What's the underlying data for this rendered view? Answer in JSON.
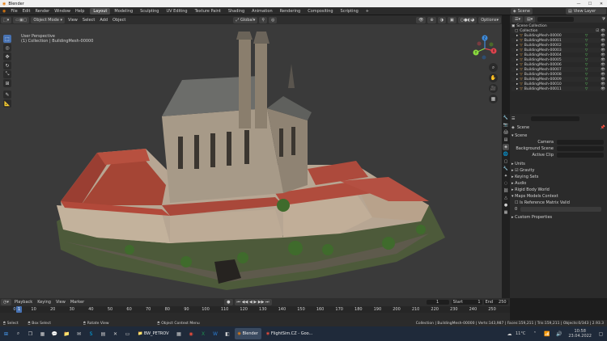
{
  "window": {
    "title": "Blender"
  },
  "menu": [
    "File",
    "Edit",
    "Render",
    "Window",
    "Help"
  ],
  "workspaces": [
    "Layout",
    "Modeling",
    "Sculpting",
    "UV Editing",
    "Texture Paint",
    "Shading",
    "Animation",
    "Rendering",
    "Compositing",
    "Scripting"
  ],
  "active_workspace": "Layout",
  "scene": {
    "name": "Scene",
    "view_layer": "View Layer"
  },
  "viewport": {
    "mode": "Object Mode",
    "menus": [
      "View",
      "Select",
      "Add",
      "Object"
    ],
    "transform_orientation": "Global",
    "options": "Options",
    "overlay_line1": "User Perspective",
    "overlay_line2": "(1) Collection | BuildingMesh-00000",
    "gizmo": {
      "x": "X",
      "y": "Y",
      "z": "Z"
    }
  },
  "outliner": {
    "title": "Scene Collection",
    "collection": "Collection",
    "items": [
      "BuildingMesh-00000",
      "BuildingMesh-00001",
      "BuildingMesh-00002",
      "BuildingMesh-00003",
      "BuildingMesh-00004",
      "BuildingMesh-00005",
      "BuildingMesh-00006",
      "BuildingMesh-00007",
      "BuildingMesh-00008",
      "BuildingMesh-00009",
      "BuildingMesh-00010",
      "BuildingMesh-00011"
    ]
  },
  "properties": {
    "context": "Scene",
    "panel_scene": "Scene",
    "camera_label": "Camera",
    "background_scene_label": "Background Scene",
    "active_clip_label": "Active Clip",
    "units": "Units",
    "gravity": "Gravity",
    "keying_sets": "Keying Sets",
    "audio": "Audio",
    "rigid_body_world": "Rigid Body World",
    "maps_models_context": "Maps Models Context",
    "is_reference_matrix_valid": "Is Reference Matrix Valid",
    "reference_value": "0",
    "custom_properties": "Custom Properties"
  },
  "timeline": {
    "menus": [
      "Playback",
      "Keying",
      "View",
      "Marker"
    ],
    "current_frame": "1",
    "start_label": "Start",
    "start": "1",
    "end_label": "End",
    "end": "250",
    "ticks": [
      "0",
      "10",
      "20",
      "30",
      "40",
      "50",
      "60",
      "70",
      "80",
      "90",
      "100",
      "110",
      "120",
      "130",
      "140",
      "150",
      "160",
      "170",
      "180",
      "190",
      "200",
      "210",
      "220",
      "230",
      "240",
      "250"
    ]
  },
  "status": {
    "select": "Select",
    "box_select": "Box Select",
    "rotate_view": "Rotate View",
    "context_menu": "Object Context Menu",
    "stats": "Collection | BuildingMesh-00000 | Verts:143,987 | Faces:159,211 | Tris:159,211 | Objects:0/343 | 2.93.3"
  },
  "taskbar": {
    "tasks": [
      "BW_PETROV",
      "Blender",
      "FlightSim.CZ - Goo..."
    ],
    "temperature": "11°C",
    "time": "10:58",
    "date": "23.04.2022"
  }
}
